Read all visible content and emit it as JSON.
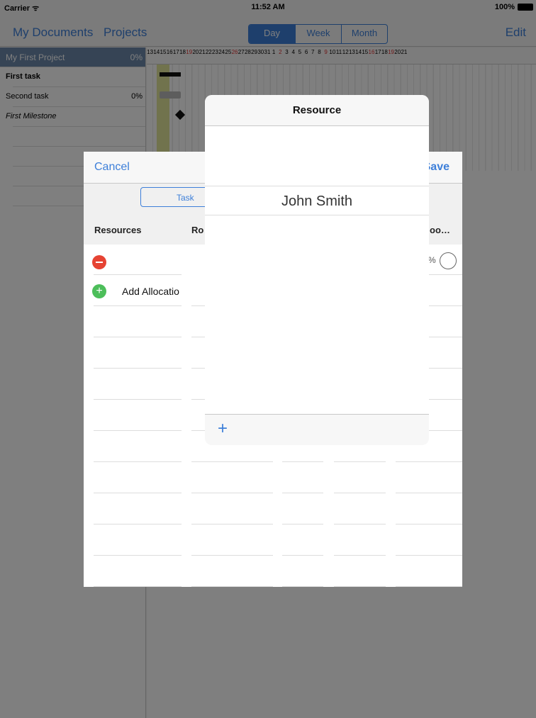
{
  "status_bar": {
    "carrier": "Carrier ᯤ",
    "time": "11:52 AM",
    "battery": "100%"
  },
  "nav": {
    "left_button": "My Documents",
    "projects_button": "Projects",
    "edit_button": "Edit",
    "segments": [
      "Day",
      "Week",
      "Month"
    ]
  },
  "tasks": [
    {
      "name": "My First Project",
      "percent": "0%"
    },
    {
      "name": "First task",
      "percent": ""
    },
    {
      "name": "Second task",
      "percent": "0%"
    },
    {
      "name": "First Milestone",
      "percent": ""
    }
  ],
  "gantt": {
    "days": [
      "13",
      "14",
      "15",
      "16",
      "17",
      "18",
      "19",
      "20",
      "21",
      "22",
      "23",
      "24",
      "25",
      "26",
      "27",
      "28",
      "29",
      "30",
      "31",
      "1",
      "2",
      "3",
      "4",
      "5",
      "6",
      "7",
      "8",
      "9",
      "10",
      "11",
      "12",
      "13",
      "14",
      "15",
      "16",
      "17",
      "18",
      "19",
      "20",
      "21"
    ],
    "red_days": [
      "19",
      "26",
      "2",
      "9",
      "16"
    ]
  },
  "sheet": {
    "cancel": "Cancel",
    "save": "Save",
    "segment_task": "Task",
    "col_resources": "Resources",
    "col_role": "Ro",
    "col_right": "oo…",
    "add_allocation": "Add Allocatio",
    "pct": "%"
  },
  "popover": {
    "title": "Resource",
    "resource": "John Smith",
    "add": "+"
  }
}
